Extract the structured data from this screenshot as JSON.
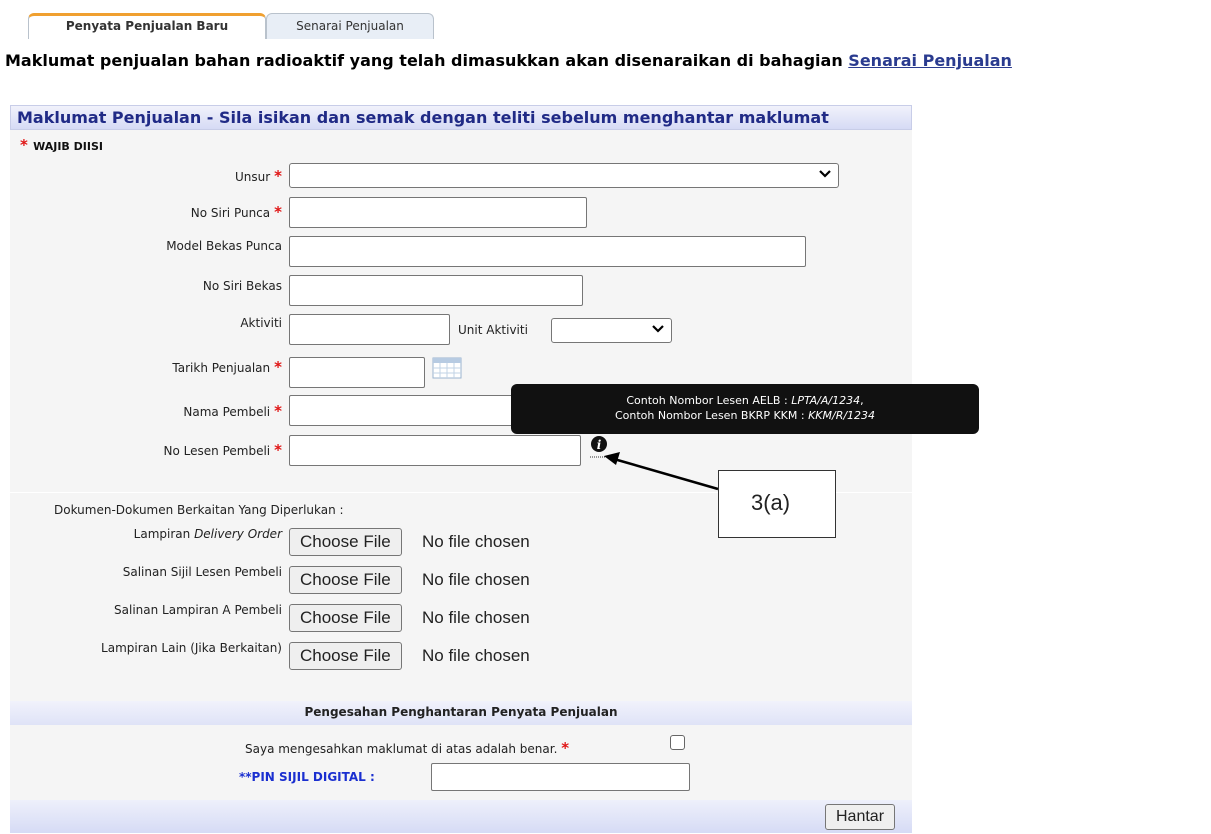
{
  "tabs": [
    {
      "label": "Penyata Penjualan Baru",
      "active": true
    },
    {
      "label": "Senarai Penjualan",
      "active": false
    }
  ],
  "notice": {
    "text": "Maklumat penjualan bahan radioaktif yang telah dimasukkan akan disenaraikan di bahagian ",
    "link": "Senarai Penjualan"
  },
  "section": {
    "title": "Maklumat Penjualan - Sila isikan dan semak dengan teliti sebelum menghantar maklumat",
    "required_note": "WAJIB DIISI"
  },
  "fields": {
    "unsur": {
      "label": "Unsur",
      "value": ""
    },
    "no_siri_punca": {
      "label": "No Siri Punca",
      "value": ""
    },
    "model_bekas_punca": {
      "label": "Model Bekas Punca",
      "value": ""
    },
    "no_siri_bekas": {
      "label": "No Siri Bekas",
      "value": ""
    },
    "aktiviti": {
      "label": "Aktiviti",
      "value": ""
    },
    "unit_aktiviti": {
      "label": "Unit Aktiviti",
      "value": ""
    },
    "tarikh_penjualan": {
      "label": "Tarikh Penjualan",
      "value": ""
    },
    "nama_pembeli": {
      "label": "Nama Pembeli",
      "value": ""
    },
    "no_lesen_pembeli": {
      "label": "No Lesen Pembeli",
      "value": ""
    }
  },
  "tooltip": {
    "line1_prefix": "Contoh Nombor Lesen AELB : ",
    "line1_value": "LPTA/A/1234",
    "line1_suffix": ",",
    "line2_prefix": "Contoh Nombor Lesen BKRP KKM : ",
    "line2_value": "KKM/R/1234"
  },
  "documents": {
    "heading": "Dokumen-Dokumen Berkaitan Yang Diperlukan :",
    "items": [
      {
        "label_prefix": "Lampiran ",
        "label_italic": "Delivery Order",
        "button": "Choose File",
        "status": "No file chosen"
      },
      {
        "label_prefix": "Salinan Sijil Lesen Pembeli",
        "label_italic": "",
        "button": "Choose File",
        "status": "No file chosen"
      },
      {
        "label_prefix": "Salinan Lampiran A Pembeli",
        "label_italic": "",
        "button": "Choose File",
        "status": "No file chosen"
      },
      {
        "label_prefix": "Lampiran Lain (Jika Berkaitan)",
        "label_italic": "",
        "button": "Choose File",
        "status": "No file chosen"
      }
    ]
  },
  "confirmation": {
    "heading": "Pengesahan Penghantaran Penyata Penjualan",
    "checkbox_label": "Saya mengesahkan maklumat di atas adalah benar.",
    "checked": false,
    "pin_label": "**PIN SIJIL DIGITAL :",
    "pin_value": ""
  },
  "submit_label": "Hantar",
  "callout_label": "3(a)",
  "colors": {
    "required": "#e01515",
    "header_text": "#202a86",
    "pin_label": "#1a2fd0",
    "tab_accent": "#f0a030"
  }
}
